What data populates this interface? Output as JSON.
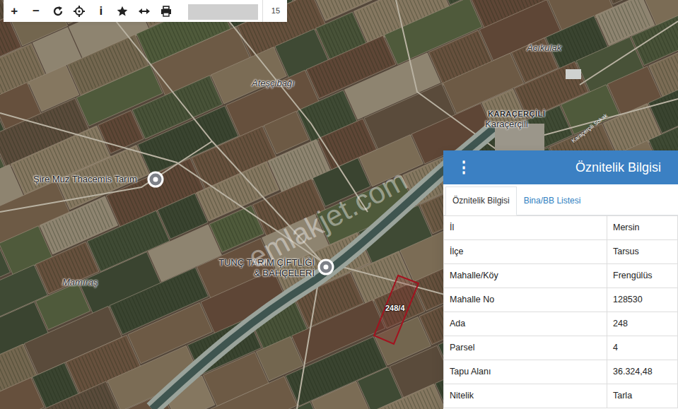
{
  "toolbar": {
    "buttons": [
      {
        "kind": "glyph",
        "text": "+"
      },
      {
        "kind": "glyph",
        "text": "−"
      },
      {
        "kind": "refresh"
      },
      {
        "kind": "locate"
      },
      {
        "kind": "glyph",
        "text": "i"
      },
      {
        "kind": "star"
      },
      {
        "kind": "measure"
      },
      {
        "kind": "print"
      }
    ],
    "zoom": "15"
  },
  "map": {
    "labels": [
      {
        "text": "Ateşçibağı",
        "kind": "place"
      },
      {
        "text": "Acıkulak",
        "kind": "place"
      },
      {
        "text": "KARAÇERÇİLİ",
        "kind": "caps"
      },
      {
        "text": "Karaçerçili",
        "kind": "place"
      },
      {
        "text": "Mamıraş",
        "kind": "place"
      },
      {
        "text": "Karaçerçili Sokak",
        "kind": "road"
      }
    ],
    "pins": [
      {
        "lines": [
          "Şire Muz Thacemis Tarım"
        ]
      },
      {
        "lines": [
          "TUNÇ TARIM ÇİFTLİĞİ",
          "& BAHÇELERİ"
        ]
      }
    ],
    "parcel": {
      "label": "248/4"
    },
    "watermark": "emlakjet.com"
  },
  "panel": {
    "menu_icon": "⋮",
    "title": "Öznitelik Bilgisi",
    "tabs": [
      {
        "label": "Öznitelik Bilgisi",
        "selected": true
      },
      {
        "label": "Bina/BB Listesi",
        "selected": false
      }
    ],
    "rows": [
      [
        "İl",
        "Mersin"
      ],
      [
        "İlçe",
        "Tarsus"
      ],
      [
        "Mahalle/Köy",
        "Frengülüs"
      ],
      [
        "Mahalle No",
        "128530"
      ],
      [
        "Ada",
        "248"
      ],
      [
        "Parsel",
        "4"
      ],
      [
        "Tapu Alanı",
        "36.324,48"
      ],
      [
        "Nitelik",
        "Tarla"
      ]
    ]
  }
}
